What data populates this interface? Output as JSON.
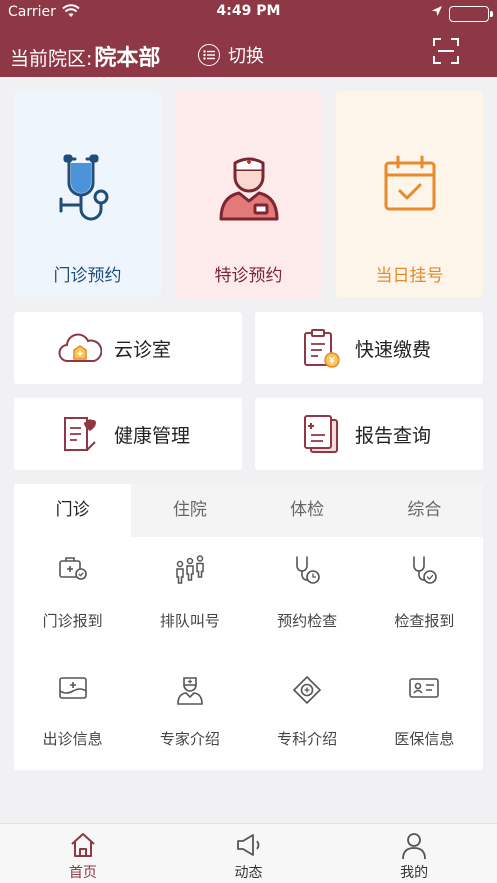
{
  "status": {
    "carrier": "Carrier",
    "time": "4:49 PM"
  },
  "header": {
    "campus_prefix": "当前院区:",
    "campus_name": "院本部",
    "switch_label": "切换"
  },
  "main_services": [
    {
      "label": "门诊预约",
      "icon": "stethoscope-icon",
      "color": "#1e4e79"
    },
    {
      "label": "特诊预约",
      "icon": "nurse-icon",
      "color": "#8e3745"
    },
    {
      "label": "当日挂号",
      "icon": "calendar-check-icon",
      "color": "#e88a2b"
    }
  ],
  "quick_services": [
    {
      "label": "云诊室",
      "icon": "cloud-clinic-icon"
    },
    {
      "label": "快速缴费",
      "icon": "payment-icon"
    },
    {
      "label": "健康管理",
      "icon": "health-record-icon"
    },
    {
      "label": "报告查询",
      "icon": "report-icon"
    }
  ],
  "tabs": [
    {
      "label": "门诊",
      "active": true
    },
    {
      "label": "住院",
      "active": false
    },
    {
      "label": "体检",
      "active": false
    },
    {
      "label": "综合",
      "active": false
    }
  ],
  "outpatient_items": [
    {
      "label": "门诊报到",
      "icon": "checkin-kit-icon"
    },
    {
      "label": "排队叫号",
      "icon": "queue-icon"
    },
    {
      "label": "预约检查",
      "icon": "stethoscope-clock-icon"
    },
    {
      "label": "检查报到",
      "icon": "stethoscope-check-icon"
    },
    {
      "label": "出诊信息",
      "icon": "schedule-board-icon"
    },
    {
      "label": "专家介绍",
      "icon": "doctor-icon"
    },
    {
      "label": "专科介绍",
      "icon": "department-icon"
    },
    {
      "label": "医保信息",
      "icon": "insurance-card-icon"
    }
  ],
  "bottom_nav": [
    {
      "label": "首页",
      "icon": "home-icon",
      "active": true
    },
    {
      "label": "动态",
      "icon": "megaphone-icon",
      "active": false
    },
    {
      "label": "我的",
      "icon": "profile-icon",
      "active": false
    }
  ],
  "colors": {
    "brand": "#8e3745",
    "background": "#f1f1f3"
  }
}
